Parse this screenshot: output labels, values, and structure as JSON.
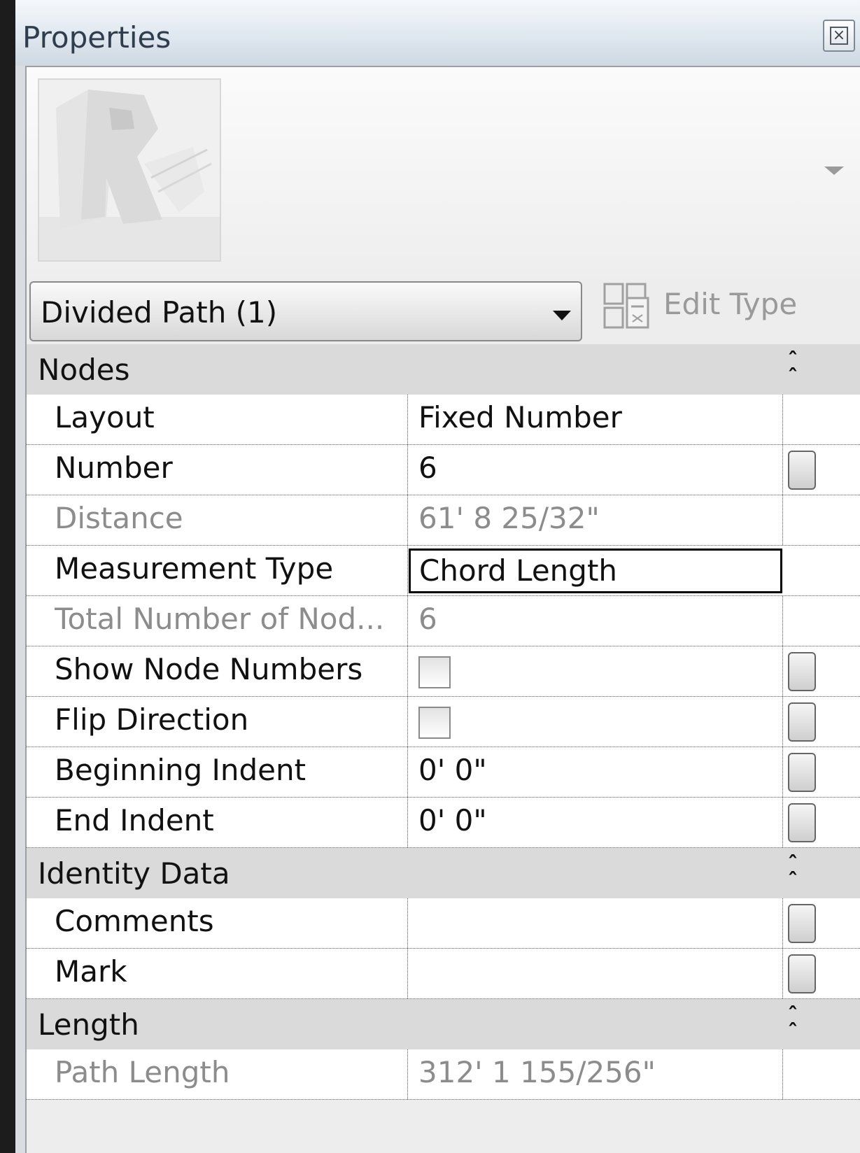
{
  "window": {
    "title": "Properties",
    "close_icon": "close-icon",
    "close_glyph": "☒"
  },
  "preview": {
    "thumbnail_icon": "revit-r-logo",
    "dropdown_icon": "chevron-down-icon"
  },
  "type_selector": {
    "label": "Divided Path (1)",
    "dropdown_icon": "chevron-down-icon"
  },
  "edit_type": {
    "label": "Edit Type",
    "icon": "edit-type-icon",
    "enabled": false
  },
  "groups": [
    {
      "name": "Nodes",
      "collapse_glyph": "ˆ",
      "rows": [
        {
          "name": "Layout",
          "value": "Fixed Number",
          "readonly": false
        },
        {
          "name": "Number",
          "value": "6",
          "readonly": false
        },
        {
          "name": "Distance",
          "value": "61'  8 25/32\"",
          "readonly": true
        },
        {
          "name": "Measurement Type",
          "value": "Chord Length",
          "readonly": false,
          "active": true
        },
        {
          "name": "Total Number of Nod...",
          "value": "6",
          "readonly": true
        },
        {
          "name": "Show Node Numbers",
          "value": "",
          "checkbox": true,
          "checked": false
        },
        {
          "name": "Flip Direction",
          "value": "",
          "checkbox": true,
          "checked": false
        },
        {
          "name": "Beginning Indent",
          "value": "0'  0\"",
          "readonly": false
        },
        {
          "name": "End Indent",
          "value": "0'  0\"",
          "readonly": false
        }
      ]
    },
    {
      "name": "Identity Data",
      "collapse_glyph": "ˆ",
      "rows": [
        {
          "name": "Comments",
          "value": "",
          "readonly": false
        },
        {
          "name": "Mark",
          "value": "",
          "readonly": false
        }
      ]
    },
    {
      "name": "Length",
      "collapse_glyph": "ˆ",
      "rows": [
        {
          "name": "Path Length",
          "value": "312'  1 155/256\"",
          "readonly": true
        }
      ]
    }
  ]
}
